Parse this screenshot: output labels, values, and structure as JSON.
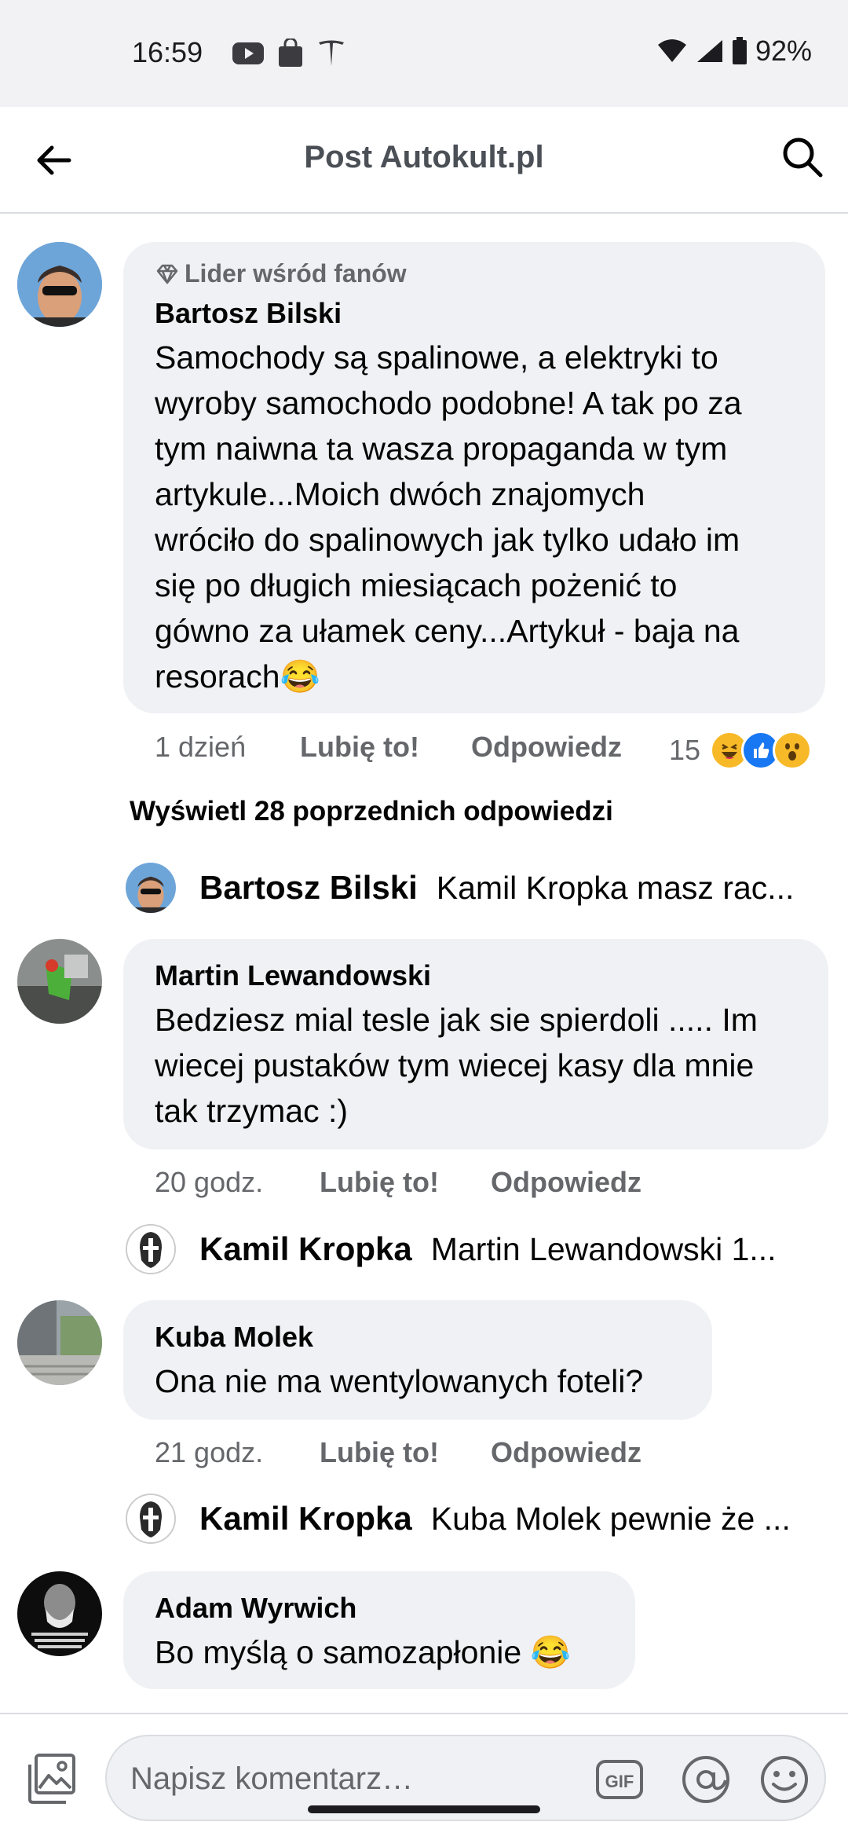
{
  "status_bar": {
    "time": "16:59",
    "battery": "92%"
  },
  "app_bar": {
    "title": "Post Autokult.pl"
  },
  "comments": [
    {
      "badge": "Lider wśród fanów",
      "author": "Bartosz Bilski",
      "lines": [
        "Samochody są spalinowe, a elektryki to",
        "wyroby samochodo podobne! A tak po za",
        "tym naiwna ta wasza propaganda w tym",
        "artykule...Moich dwóch znajomych",
        "wróciło do spalinowych jak tylko udało im",
        "się po długich miesiącach pożenić to",
        "gówno za ułamek ceny...Artykuł - baja na",
        "resorach😂"
      ],
      "time": "1 dzień",
      "like": "Lubię to!",
      "reply": "Odpowiedz",
      "reaction_count": "15",
      "reactions": [
        "haha",
        "like",
        "wow"
      ]
    },
    {
      "author": "Martin Lewandowski",
      "lines": [
        "Bedziesz mial tesle jak sie spierdoli ..... Im",
        "wiecej pustaków tym wiecej kasy dla mnie",
        "tak trzymac :)"
      ],
      "time": "20 godz.",
      "like": "Lubię to!",
      "reply": "Odpowiedz"
    },
    {
      "author": "Kuba Molek",
      "lines": [
        "Ona nie ma wentylowanych foteli?"
      ],
      "time": "21 godz.",
      "like": "Lubię to!",
      "reply": "Odpowiedz"
    },
    {
      "author": "Adam Wyrwich",
      "lines": [
        "Bo myślą o samozapłonie 😂"
      ]
    }
  ],
  "view_previous": "Wyświetl 28 poprzednich odpowiedzi",
  "reply_previews": [
    {
      "name": "Bartosz Bilski",
      "text": "Kamil Kropka masz rac..."
    },
    {
      "name": "Kamil Kropka",
      "text": "Martin Lewandowski 1..."
    },
    {
      "name": "Kamil Kropka",
      "text": "Kuba Molek pewnie że ..."
    }
  ],
  "composer": {
    "placeholder": "Napisz komentarz…",
    "gif_label": "GIF"
  }
}
